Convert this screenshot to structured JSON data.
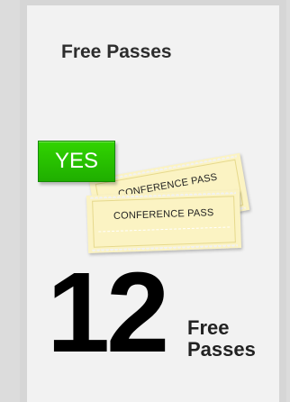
{
  "card": {
    "title": "Free Passes",
    "badge": "YES",
    "tickets": {
      "back_label": "CONFERENCE PASS",
      "front_label": "CONFERENCE PASS"
    },
    "count": "12",
    "count_label_line1": "Free",
    "count_label_line2": "Passes"
  },
  "colors": {
    "badge_green": "#2ec800",
    "ticket_yellow": "#fbf3c3",
    "card_background": "#f2f2f2"
  }
}
